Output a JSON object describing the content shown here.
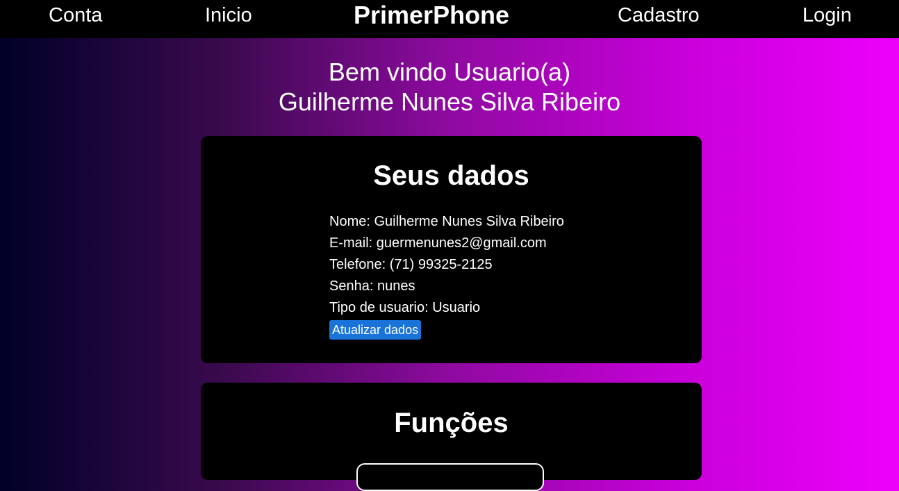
{
  "nav": {
    "conta": "Conta",
    "inicio": "Inicio",
    "brand": "PrimerPhone",
    "cadastro": "Cadastro",
    "login": "Login"
  },
  "welcome": {
    "line1": "Bem vindo Usuario(a)",
    "line2": "Guilherme Nunes Silva Ribeiro"
  },
  "user_data": {
    "title": "Seus dados",
    "fields": [
      "Nome: Guilherme Nunes Silva Ribeiro",
      "E-mail: guermenunes2@gmail.com",
      "Telefone: (71) 99325-2125",
      "Senha: nunes",
      "Tipo de usuario: Usuario"
    ],
    "update_label": "Atualizar dados"
  },
  "functions": {
    "title": "Funções"
  },
  "colors": {
    "background_gradient_start": "#000028",
    "background_gradient_end": "#ee00fb",
    "nav_background": "#000000",
    "card_background": "#000000",
    "button_accent": "#1a73d9"
  }
}
